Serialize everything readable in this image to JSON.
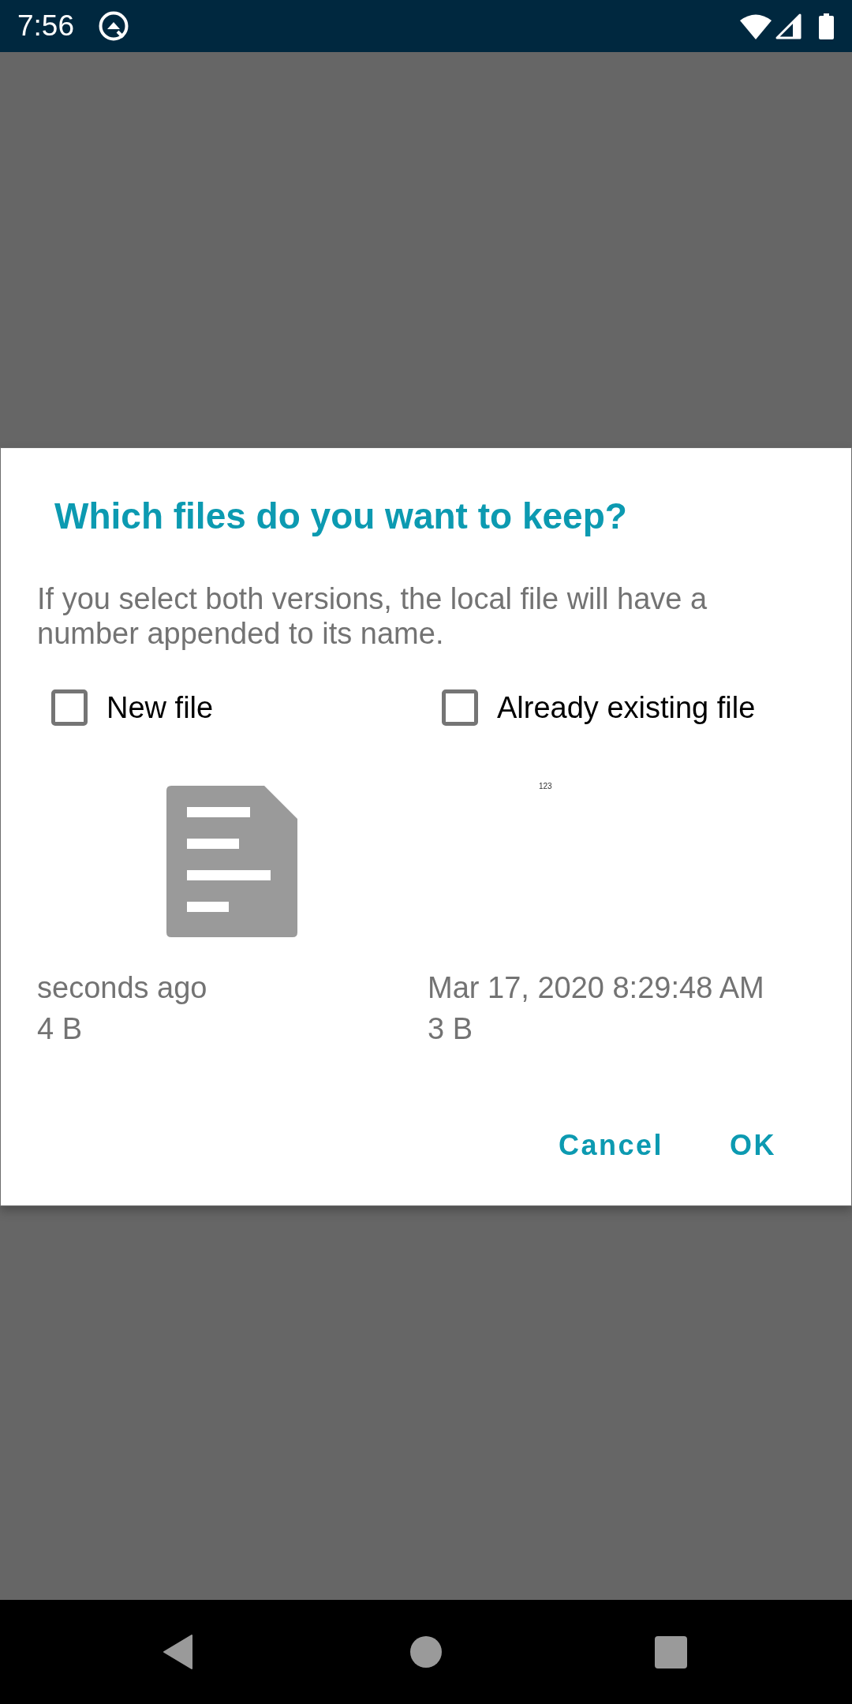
{
  "status_bar": {
    "time": "7:56"
  },
  "dialog": {
    "title": "Which files do you want to keep?",
    "message": "If you select both versions, the local file will have a number appended to its name.",
    "files": [
      {
        "label": "New file",
        "checked": false,
        "kind": "icon",
        "date": "seconds ago",
        "size": "4 B"
      },
      {
        "label": "Already existing file",
        "checked": false,
        "kind": "thumbnail",
        "thumbnail_text": "123",
        "date": "Mar 17, 2020 8:29:48 AM",
        "size": "3 B"
      }
    ],
    "buttons": [
      {
        "label": "Cancel"
      },
      {
        "label": "OK"
      }
    ]
  }
}
